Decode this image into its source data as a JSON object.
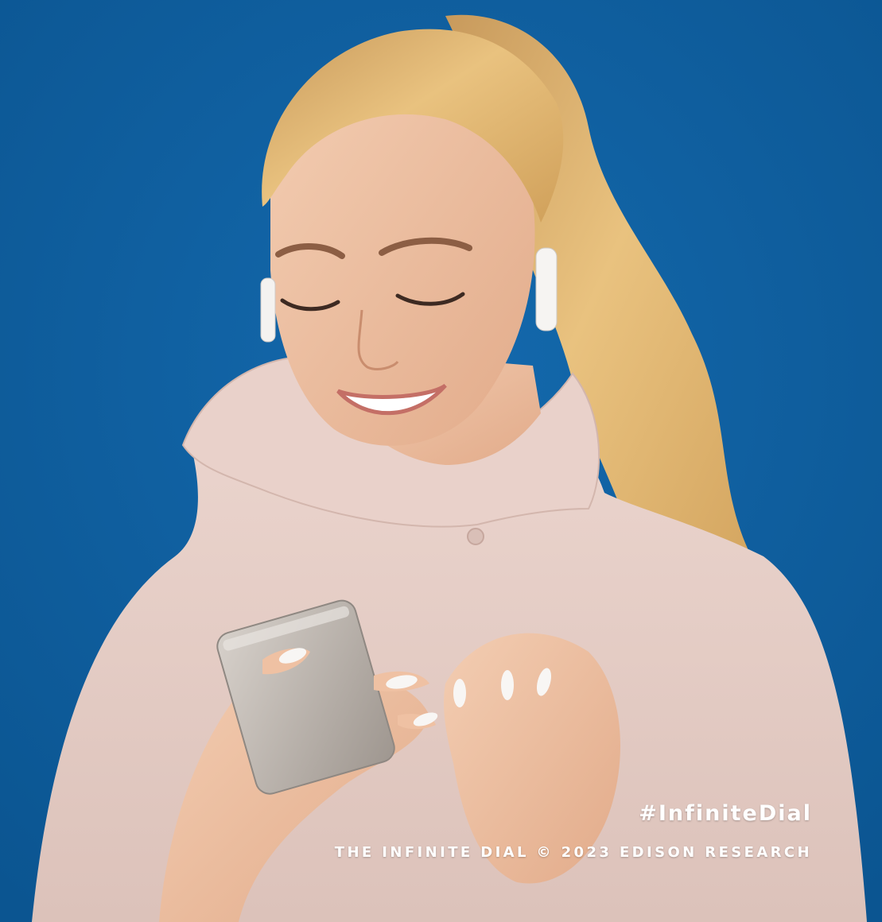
{
  "background_color": "#0c5c9c",
  "photo_subject": "smiling woman with blonde ponytail wearing pink hooded coat and white wireless earbuds, using a smartphone",
  "hashtag": "#InfiniteDial",
  "copyright": "THE INFINITE DIAL © 2023 EDISON RESEARCH",
  "colors": {
    "background": "#0c5c9c",
    "coat": "#e6cfc9",
    "hair": "#dcae6a",
    "skin": "#efc1a3",
    "phone": "#b9b2ab",
    "text": "#ffffff"
  }
}
